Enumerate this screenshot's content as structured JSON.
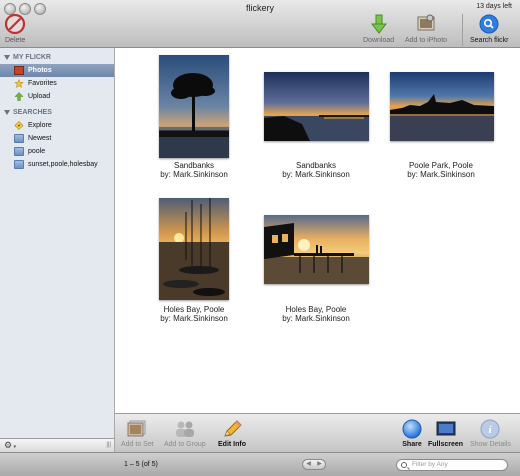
{
  "window": {
    "title": "flickery",
    "trial_notice": "13 days left"
  },
  "toolbar": {
    "delete_label": "Delete",
    "download_label": "Download",
    "add_iphoto_label": "Add to iPhoto",
    "search_label": "Search flickr"
  },
  "sidebar": {
    "my_flickr_header": "MY FLICKR",
    "my_flickr_items": [
      {
        "label": "Photos",
        "icon": "photos-icon",
        "selected": true
      },
      {
        "label": "Favorites",
        "icon": "star-icon",
        "selected": false
      },
      {
        "label": "Upload",
        "icon": "upload-icon",
        "selected": false
      }
    ],
    "searches_header": "SEARCHES",
    "search_items": [
      {
        "label": "Explore",
        "icon": "explore-icon"
      },
      {
        "label": "Newest",
        "icon": "folder-icon"
      },
      {
        "label": "poole",
        "icon": "folder-icon"
      },
      {
        "label": "sunset,poole,holesbay",
        "icon": "folder-icon"
      }
    ],
    "footer": {
      "gear": "⚙",
      "grip": "|||"
    }
  },
  "photos": [
    {
      "title": "Sandbanks",
      "byline": "by: Mark.Sinkinson",
      "scene": "tree-sunset"
    },
    {
      "title": "Sandbanks",
      "byline": "by: Mark.Sinkinson",
      "scene": "shore-dusk"
    },
    {
      "title": "Poole Park, Poole",
      "byline": "by: Mark.Sinkinson",
      "scene": "skyline-dusk"
    },
    {
      "title": "Holes Bay, Poole",
      "byline": "by: Mark.Sinkinson",
      "scene": "boats-sunset"
    },
    {
      "title": "Holes Bay, Poole",
      "byline": "by: Mark.Sinkinson",
      "scene": "jetty-sunset"
    }
  ],
  "actions": {
    "add_to_set": "Add to Set",
    "add_to_group": "Add to Group",
    "edit_info": "Edit Info",
    "share": "Share",
    "fullscreen": "Fullscreen",
    "show_details": "Show Details"
  },
  "status": {
    "count": "1 – 5 (of 5)",
    "prev": "◀",
    "next": "▶",
    "filter_placeholder": "Filter by Any"
  },
  "colors": {
    "accent_blue": "#2f7de1",
    "selection": "#7e95b8",
    "download_green": "#5caa2c",
    "delete_red": "#d23a2a"
  }
}
